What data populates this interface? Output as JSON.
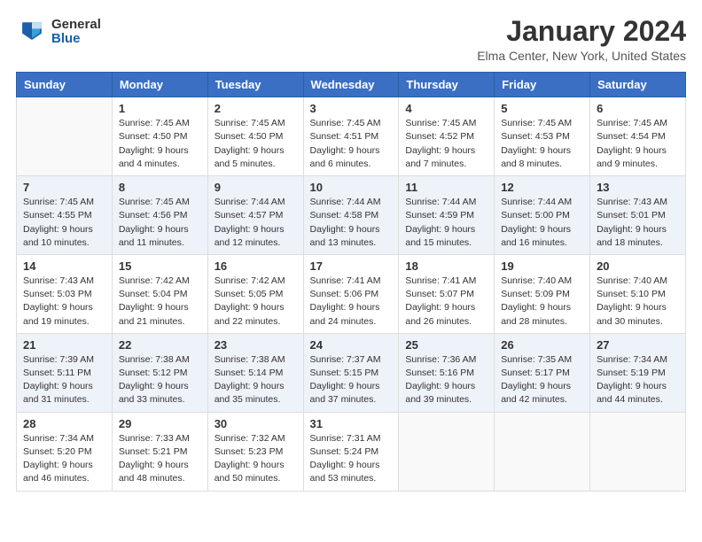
{
  "header": {
    "logo_general": "General",
    "logo_blue": "Blue",
    "month_title": "January 2024",
    "location": "Elma Center, New York, United States"
  },
  "days_of_week": [
    "Sunday",
    "Monday",
    "Tuesday",
    "Wednesday",
    "Thursday",
    "Friday",
    "Saturday"
  ],
  "weeks": [
    [
      {
        "day": "",
        "info": ""
      },
      {
        "day": "1",
        "info": "Sunrise: 7:45 AM\nSunset: 4:50 PM\nDaylight: 9 hours\nand 4 minutes."
      },
      {
        "day": "2",
        "info": "Sunrise: 7:45 AM\nSunset: 4:50 PM\nDaylight: 9 hours\nand 5 minutes."
      },
      {
        "day": "3",
        "info": "Sunrise: 7:45 AM\nSunset: 4:51 PM\nDaylight: 9 hours\nand 6 minutes."
      },
      {
        "day": "4",
        "info": "Sunrise: 7:45 AM\nSunset: 4:52 PM\nDaylight: 9 hours\nand 7 minutes."
      },
      {
        "day": "5",
        "info": "Sunrise: 7:45 AM\nSunset: 4:53 PM\nDaylight: 9 hours\nand 8 minutes."
      },
      {
        "day": "6",
        "info": "Sunrise: 7:45 AM\nSunset: 4:54 PM\nDaylight: 9 hours\nand 9 minutes."
      }
    ],
    [
      {
        "day": "7",
        "info": "Sunrise: 7:45 AM\nSunset: 4:55 PM\nDaylight: 9 hours\nand 10 minutes."
      },
      {
        "day": "8",
        "info": "Sunrise: 7:45 AM\nSunset: 4:56 PM\nDaylight: 9 hours\nand 11 minutes."
      },
      {
        "day": "9",
        "info": "Sunrise: 7:44 AM\nSunset: 4:57 PM\nDaylight: 9 hours\nand 12 minutes."
      },
      {
        "day": "10",
        "info": "Sunrise: 7:44 AM\nSunset: 4:58 PM\nDaylight: 9 hours\nand 13 minutes."
      },
      {
        "day": "11",
        "info": "Sunrise: 7:44 AM\nSunset: 4:59 PM\nDaylight: 9 hours\nand 15 minutes."
      },
      {
        "day": "12",
        "info": "Sunrise: 7:44 AM\nSunset: 5:00 PM\nDaylight: 9 hours\nand 16 minutes."
      },
      {
        "day": "13",
        "info": "Sunrise: 7:43 AM\nSunset: 5:01 PM\nDaylight: 9 hours\nand 18 minutes."
      }
    ],
    [
      {
        "day": "14",
        "info": "Sunrise: 7:43 AM\nSunset: 5:03 PM\nDaylight: 9 hours\nand 19 minutes."
      },
      {
        "day": "15",
        "info": "Sunrise: 7:42 AM\nSunset: 5:04 PM\nDaylight: 9 hours\nand 21 minutes."
      },
      {
        "day": "16",
        "info": "Sunrise: 7:42 AM\nSunset: 5:05 PM\nDaylight: 9 hours\nand 22 minutes."
      },
      {
        "day": "17",
        "info": "Sunrise: 7:41 AM\nSunset: 5:06 PM\nDaylight: 9 hours\nand 24 minutes."
      },
      {
        "day": "18",
        "info": "Sunrise: 7:41 AM\nSunset: 5:07 PM\nDaylight: 9 hours\nand 26 minutes."
      },
      {
        "day": "19",
        "info": "Sunrise: 7:40 AM\nSunset: 5:09 PM\nDaylight: 9 hours\nand 28 minutes."
      },
      {
        "day": "20",
        "info": "Sunrise: 7:40 AM\nSunset: 5:10 PM\nDaylight: 9 hours\nand 30 minutes."
      }
    ],
    [
      {
        "day": "21",
        "info": "Sunrise: 7:39 AM\nSunset: 5:11 PM\nDaylight: 9 hours\nand 31 minutes."
      },
      {
        "day": "22",
        "info": "Sunrise: 7:38 AM\nSunset: 5:12 PM\nDaylight: 9 hours\nand 33 minutes."
      },
      {
        "day": "23",
        "info": "Sunrise: 7:38 AM\nSunset: 5:14 PM\nDaylight: 9 hours\nand 35 minutes."
      },
      {
        "day": "24",
        "info": "Sunrise: 7:37 AM\nSunset: 5:15 PM\nDaylight: 9 hours\nand 37 minutes."
      },
      {
        "day": "25",
        "info": "Sunrise: 7:36 AM\nSunset: 5:16 PM\nDaylight: 9 hours\nand 39 minutes."
      },
      {
        "day": "26",
        "info": "Sunrise: 7:35 AM\nSunset: 5:17 PM\nDaylight: 9 hours\nand 42 minutes."
      },
      {
        "day": "27",
        "info": "Sunrise: 7:34 AM\nSunset: 5:19 PM\nDaylight: 9 hours\nand 44 minutes."
      }
    ],
    [
      {
        "day": "28",
        "info": "Sunrise: 7:34 AM\nSunset: 5:20 PM\nDaylight: 9 hours\nand 46 minutes."
      },
      {
        "day": "29",
        "info": "Sunrise: 7:33 AM\nSunset: 5:21 PM\nDaylight: 9 hours\nand 48 minutes."
      },
      {
        "day": "30",
        "info": "Sunrise: 7:32 AM\nSunset: 5:23 PM\nDaylight: 9 hours\nand 50 minutes."
      },
      {
        "day": "31",
        "info": "Sunrise: 7:31 AM\nSunset: 5:24 PM\nDaylight: 9 hours\nand 53 minutes."
      },
      {
        "day": "",
        "info": ""
      },
      {
        "day": "",
        "info": ""
      },
      {
        "day": "",
        "info": ""
      }
    ]
  ]
}
